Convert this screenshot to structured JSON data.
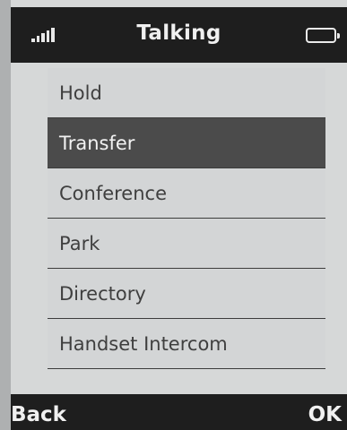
{
  "header": {
    "title": "Talking",
    "signal_icon": "signal-strength-icon",
    "battery_icon": "battery-icon"
  },
  "menu": {
    "items": [
      {
        "label": "Hold",
        "selected": false
      },
      {
        "label": "Transfer",
        "selected": true
      },
      {
        "label": "Conference",
        "selected": false
      },
      {
        "label": "Park",
        "selected": false
      },
      {
        "label": "Directory",
        "selected": false
      },
      {
        "label": "Handset Intercom",
        "selected": false
      }
    ]
  },
  "softkeys": {
    "left": "Back",
    "right": "OK"
  },
  "colors": {
    "bar": "#1e1e1e",
    "selected_row": "#4b4b4b",
    "screen": "#d6d8d8"
  }
}
